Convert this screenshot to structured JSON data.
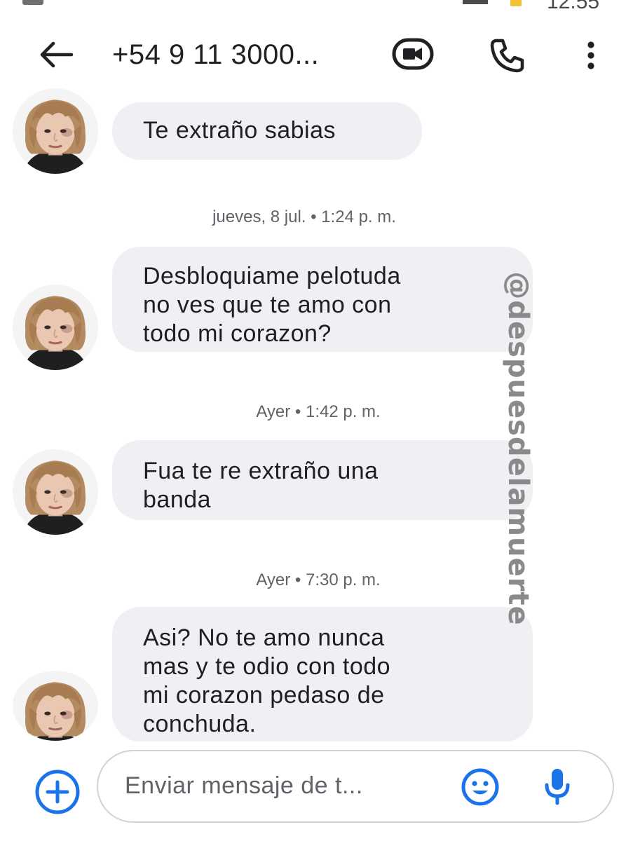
{
  "status_bar": {
    "time": "12:55"
  },
  "header": {
    "contact": "+54 9 11 3000...",
    "icons": {
      "back": "arrow-back-icon",
      "video": "video-call-icon",
      "call": "phone-icon",
      "more": "more-vert-icon"
    }
  },
  "conversation": {
    "messages": [
      {
        "lines": [
          "Te extraño sabias"
        ]
      },
      {
        "lines": [
          "Desbloquiame pelotuda",
          "no ves que te amo con",
          "todo mi corazon?"
        ]
      },
      {
        "lines": [
          "Fua te re extraño una",
          "banda"
        ]
      },
      {
        "lines": [
          "Asi? No te amo nunca",
          "mas y te odio con todo",
          "mi corazon pedaso de",
          "conchuda."
        ]
      }
    ],
    "timestamps": [
      "jueves, 8 jul. • 1:24 p. m.",
      "Ayer • 1:42 p. m.",
      "Ayer • 7:30 p. m."
    ]
  },
  "watermark": "@despuesdelamuerte",
  "compose": {
    "placeholder": "Enviar mensaje de t...",
    "icons": {
      "add": "add-circle-icon",
      "emoji": "emoji-icon",
      "mic": "microphone-icon"
    }
  },
  "colors": {
    "accent": "#1a73e8",
    "bubble": "#eef0f4",
    "text": "#1f1f1f",
    "secondary_text": "#5f6368",
    "watermark": "#8a8a8a"
  }
}
